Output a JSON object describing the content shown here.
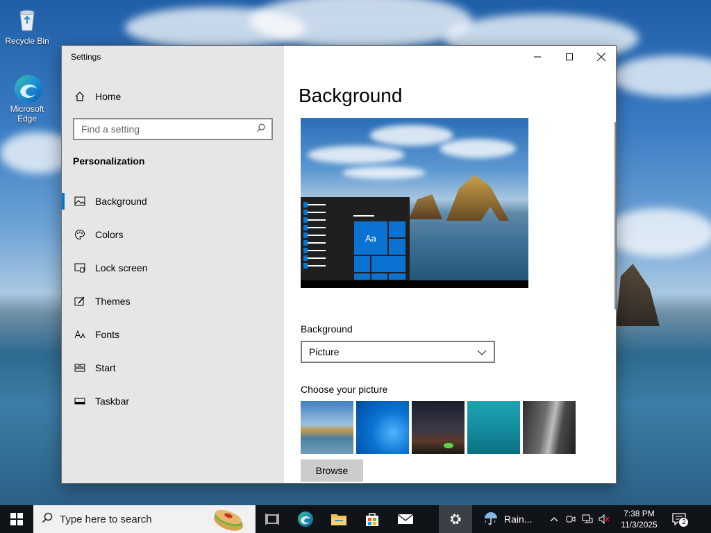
{
  "desktop": {
    "icons": [
      {
        "label": "Recycle Bin",
        "icon": "recycle-bin-icon"
      },
      {
        "label": "Microsoft Edge",
        "icon": "edge-icon"
      }
    ]
  },
  "window": {
    "title": "Settings",
    "home_label": "Home",
    "search_placeholder": "Find a setting",
    "section_title": "Personalization",
    "nav_items": [
      {
        "label": "Background",
        "icon": "picture-icon",
        "active": true
      },
      {
        "label": "Colors",
        "icon": "palette-icon",
        "active": false
      },
      {
        "label": "Lock screen",
        "icon": "lock-screen-icon",
        "active": false
      },
      {
        "label": "Themes",
        "icon": "brush-icon",
        "active": false
      },
      {
        "label": "Fonts",
        "icon": "fonts-icon",
        "active": false
      },
      {
        "label": "Start",
        "icon": "start-icon",
        "active": false
      },
      {
        "label": "Taskbar",
        "icon": "taskbar-icon",
        "active": false
      }
    ]
  },
  "content": {
    "page_title": "Background",
    "preview_tile_text": "Aa",
    "background_label": "Background",
    "background_value": "Picture",
    "choose_label": "Choose your picture",
    "browse_label": "Browse"
  },
  "taskbar": {
    "search_placeholder": "Type here to search",
    "weather_text": "Rain...",
    "time": "7:38 PM",
    "date": "11/3/2025",
    "notification_count": "2"
  },
  "colors": {
    "accent": "#0078d7",
    "sidebar_bg": "#e6e6e6",
    "taskbar_bg": "#101318"
  }
}
